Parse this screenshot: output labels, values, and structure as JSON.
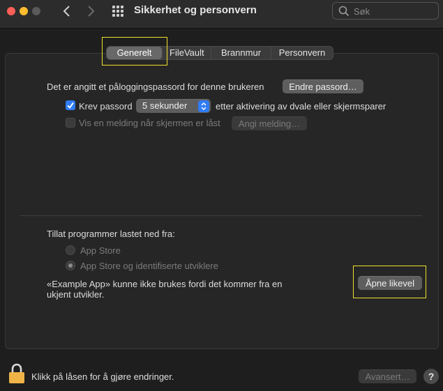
{
  "window": {
    "title": "Sikkerhet og personvern",
    "search_placeholder": "Søk"
  },
  "tabs": [
    {
      "label": "Generelt",
      "active": true
    },
    {
      "label": "FileVault",
      "active": false
    },
    {
      "label": "Brannmur",
      "active": false
    },
    {
      "label": "Personvern",
      "active": false
    }
  ],
  "general": {
    "password_text": "Det er angitt et påloggingspassord for denne brukeren",
    "change_password_button": "Endre passord…",
    "require_password_label": "Krev passord",
    "require_password_checked": true,
    "require_password_delay": "5 sekunder",
    "require_password_suffix": "etter aktivering av dvale eller skjermsparer",
    "show_message_label": "Vis en melding når skjermen er låst",
    "show_message_checked": false,
    "set_message_button": "Angi melding…"
  },
  "downloads": {
    "heading": "Tillat programmer lastet ned fra:",
    "options": [
      {
        "label": "App Store",
        "selected": false
      },
      {
        "label": "App Store og identifiserte utviklere",
        "selected": true
      }
    ],
    "blocked_message_line1": "«Example App» kunne ikke brukes fordi det kommer fra en",
    "blocked_message_line2": "ukjent utvikler.",
    "open_anyway_button": "Åpne likevel"
  },
  "footer": {
    "lock_text": "Klikk på låsen for å gjøre endringer.",
    "advanced_button": "Avansert…",
    "help_label": "?"
  },
  "colors": {
    "accent": "#2f7cf6",
    "highlight": "#f3e02a",
    "lock": "#f0b347"
  }
}
